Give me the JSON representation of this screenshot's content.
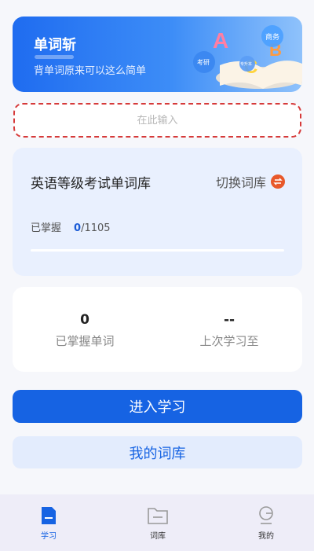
{
  "banner": {
    "title": "单词斩",
    "subtitle": "背单词原来可以这么简单",
    "art_labels": [
      "商务",
      "考研",
      "专升本"
    ]
  },
  "search": {
    "placeholder": "在此输入",
    "value": ""
  },
  "library": {
    "name": "英语等级考试单词库",
    "switch_label": "切换词库",
    "mastered_label": "已掌握",
    "mastered_count": "0",
    "total": "/1105",
    "progress_percent": 0
  },
  "stats": {
    "mastered_value": "0",
    "mastered_label": "已掌握单词",
    "last_value": "--",
    "last_label": "上次学习至"
  },
  "buttons": {
    "study": "进入学习",
    "my_library": "我的词库"
  },
  "tabs": [
    {
      "label": "学习",
      "icon": "study-icon",
      "active": true
    },
    {
      "label": "词库",
      "icon": "folder-icon",
      "active": false
    },
    {
      "label": "我的",
      "icon": "profile-icon",
      "active": false
    }
  ],
  "colors": {
    "primary": "#1663e3",
    "accent_orange": "#e8582a",
    "search_border": "#d63a3a"
  }
}
